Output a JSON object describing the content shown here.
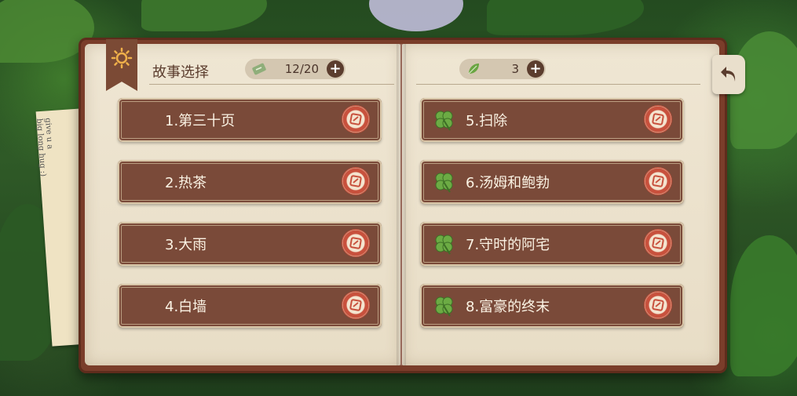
{
  "header": {
    "title": "故事选择",
    "ticket_count": "12/20",
    "leaf_count": "3",
    "add_symbol": "+"
  },
  "note": {
    "line1": "give u a",
    "line2": "big long hug :)"
  },
  "stories": [
    {
      "label": "1.第三十页",
      "cleared": false
    },
    {
      "label": "2.热茶",
      "cleared": false
    },
    {
      "label": "3.大雨",
      "cleared": false
    },
    {
      "label": "4.白墙",
      "cleared": false
    },
    {
      "label": "5.扫除",
      "cleared": true
    },
    {
      "label": "6.汤姆和鲍勃",
      "cleared": true
    },
    {
      "label": "7.守时的阿宅",
      "cleared": true
    },
    {
      "label": "8.富豪的终末",
      "cleared": true
    }
  ],
  "icons": {
    "bookmark": "sun-icon",
    "ticket": "ticket-icon",
    "leaf": "leaf-icon",
    "cleared": "clover-icon",
    "story_action": "story-stamp-icon",
    "back": "back-arrow-icon"
  },
  "colors": {
    "button_bg": "#7a4a39",
    "page_bg": "#efe6d3",
    "accent_red": "#c8513d",
    "clover_green": "#5a9a3a"
  }
}
